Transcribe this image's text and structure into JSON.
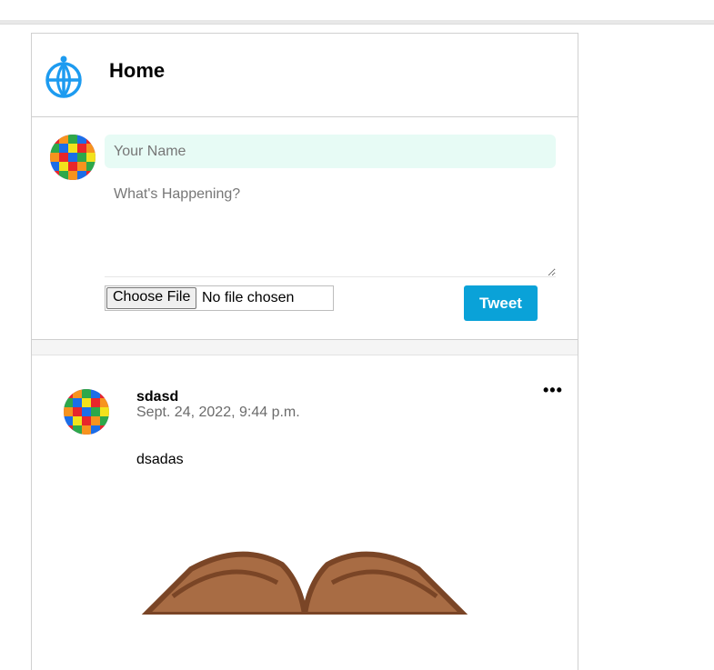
{
  "header": {
    "title": "Home",
    "logo_icon": "globe-person-icon",
    "accent": "#1d9bf0"
  },
  "composer": {
    "name_placeholder": "Your Name",
    "message_placeholder": "What's Happening?",
    "file_button_label": "Choose File",
    "file_status": "No file chosen",
    "submit_label": "Tweet",
    "submit_color": "#0aa2d8"
  },
  "tweets": [
    {
      "author": "sdasd",
      "timestamp": "Sept. 24, 2022, 9:44 p.m.",
      "body": "dsadas",
      "menu_icon": "more-dots-icon"
    }
  ]
}
